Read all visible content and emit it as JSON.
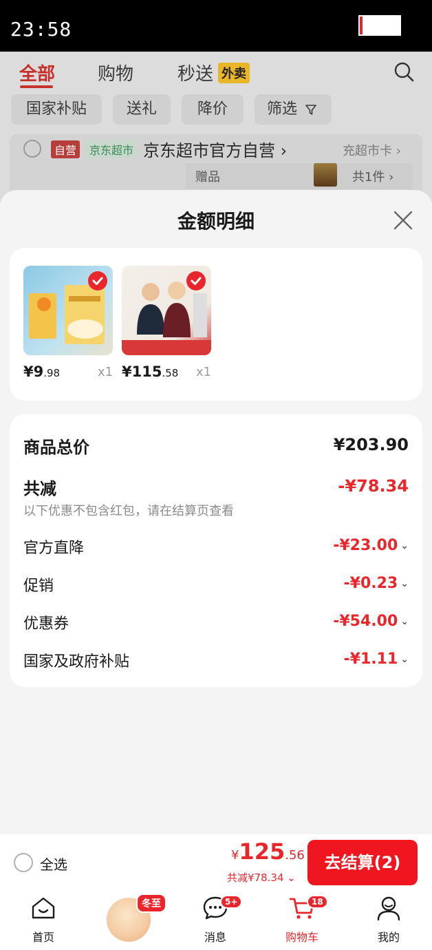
{
  "status_bar": {
    "time": "23:58"
  },
  "background": {
    "tabs": [
      {
        "label": "全部"
      },
      {
        "label": "购物"
      },
      {
        "label": "秒送"
      }
    ],
    "tab_badge": "外卖",
    "filters": [
      "国家补贴",
      "送礼",
      "降价",
      "筛选"
    ],
    "store": {
      "self_tag": "自营",
      "jd_tag": "京东超市",
      "name": "京东超市官方自营 ›",
      "link": "充超市卡 ›",
      "gift_label": "赠品",
      "gift_count": "共1件 ›"
    }
  },
  "sheet": {
    "title": "金额明细",
    "products": [
      {
        "price_int": "¥9",
        "price_dec": ".98",
        "qty": "x1"
      },
      {
        "price_int": "¥115",
        "price_dec": ".58",
        "qty": "x1"
      }
    ],
    "summary": {
      "total_label": "商品总价",
      "total_value": "¥203.90",
      "discount_label": "共减",
      "discount_value": "-¥78.34",
      "note": "以下优惠不包含红包，请在结算页查看",
      "rows": [
        {
          "label": "官方直降",
          "value": "-¥23.00"
        },
        {
          "label": "促销",
          "value": "-¥0.23"
        },
        {
          "label": "优惠券",
          "value": "-¥54.00"
        },
        {
          "label": "国家及政府补贴",
          "value": "-¥1.11"
        }
      ]
    }
  },
  "checkout": {
    "select_all": "全选",
    "yen": "¥",
    "total_int": "125",
    "total_dec": ".56",
    "saved": "共减¥78.34 ⌄",
    "button": "去结算(2)"
  },
  "nav": {
    "items": [
      {
        "label": "首页"
      },
      {
        "label": "消息",
        "badge": "5+"
      },
      {
        "label": "购物车",
        "badge": "18"
      },
      {
        "label": "我的"
      }
    ],
    "mascot_badge": "冬至"
  },
  "colors": {
    "accent": "#e8262c",
    "badge_yellow": "#e8b628"
  }
}
